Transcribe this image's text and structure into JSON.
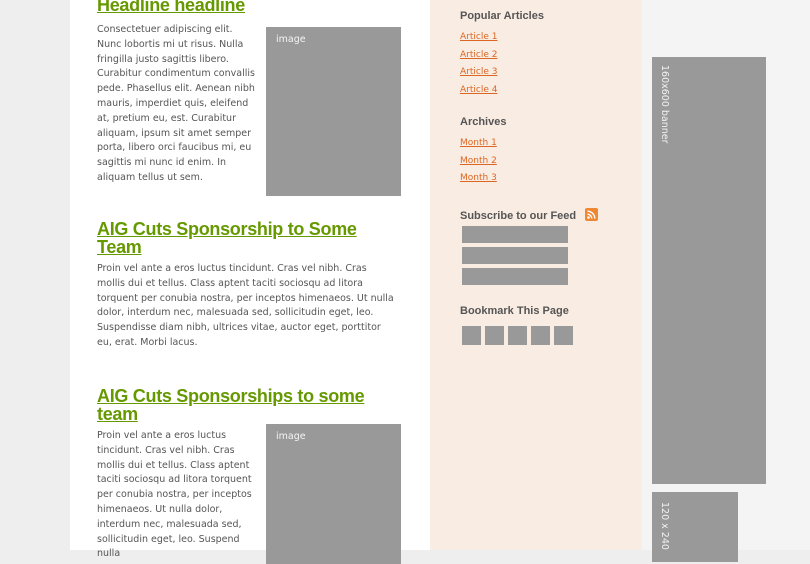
{
  "articles": [
    {
      "headline": "Headline headline",
      "body": "Consectetuer adipiscing elit. Nunc lobortis mi ut risus. Nulla fringilla justo sagittis libero. Curabitur condimentum convallis pede. Phasellus elit. Aenean nibh mauris, imperdiet quis, eleifend at, pretium eu, est. Curabitur aliquam, ipsum sit amet semper porta, libero orci faucibus mi, eu sagittis mi nunc id enim. In aliquam tellus ut sem.",
      "image_label": "image"
    },
    {
      "headline": "AIG Cuts Sponsorship to Some Team",
      "body": "Proin vel ante a eros luctus tincidunt. Cras vel nibh. Cras mollis dui et tellus. Class aptent taciti sociosqu ad litora torquent per conubia nostra, per inceptos himenaeos. Ut nulla dolor, interdum nec, malesuada sed, sollicitudin eget, leo. Suspendisse diam nibh, ultrices vitae, auctor eget, porttitor eu, erat. Morbi lacus."
    },
    {
      "headline": "AIG Cuts Sponsorships to some team",
      "body": "Proin vel ante a eros luctus tincidunt. Cras vel nibh. Cras mollis dui et tellus. Class aptent taciti sociosqu ad litora torquent per conubia nostra, per inceptos himenaeos. Ut nulla dolor, interdum nec, malesuada sed, sollicitudin eget, leo. Suspend nulla",
      "image_label": "image"
    }
  ],
  "sidebar": {
    "popular": {
      "heading": "Popular Articles",
      "items": [
        "Article 1",
        "Article 2",
        "Article 3",
        "Article 4"
      ]
    },
    "archives": {
      "heading": "Archives",
      "items": [
        "Month 1",
        "Month 2",
        "Month 3"
      ]
    },
    "subscribe": {
      "heading": "Subscribe to our Feed",
      "icon": "rss-icon",
      "icon_color": "#ee8833"
    },
    "bookmark": {
      "heading": "Bookmark This Page"
    }
  },
  "banners": {
    "skyscraper_label": "160x600 banner",
    "small_label": "120 x 240"
  },
  "colors": {
    "headline": "#669900",
    "link": "#dd6622",
    "sidebar_bg": "#f9ece3",
    "placeholder": "#999999"
  }
}
